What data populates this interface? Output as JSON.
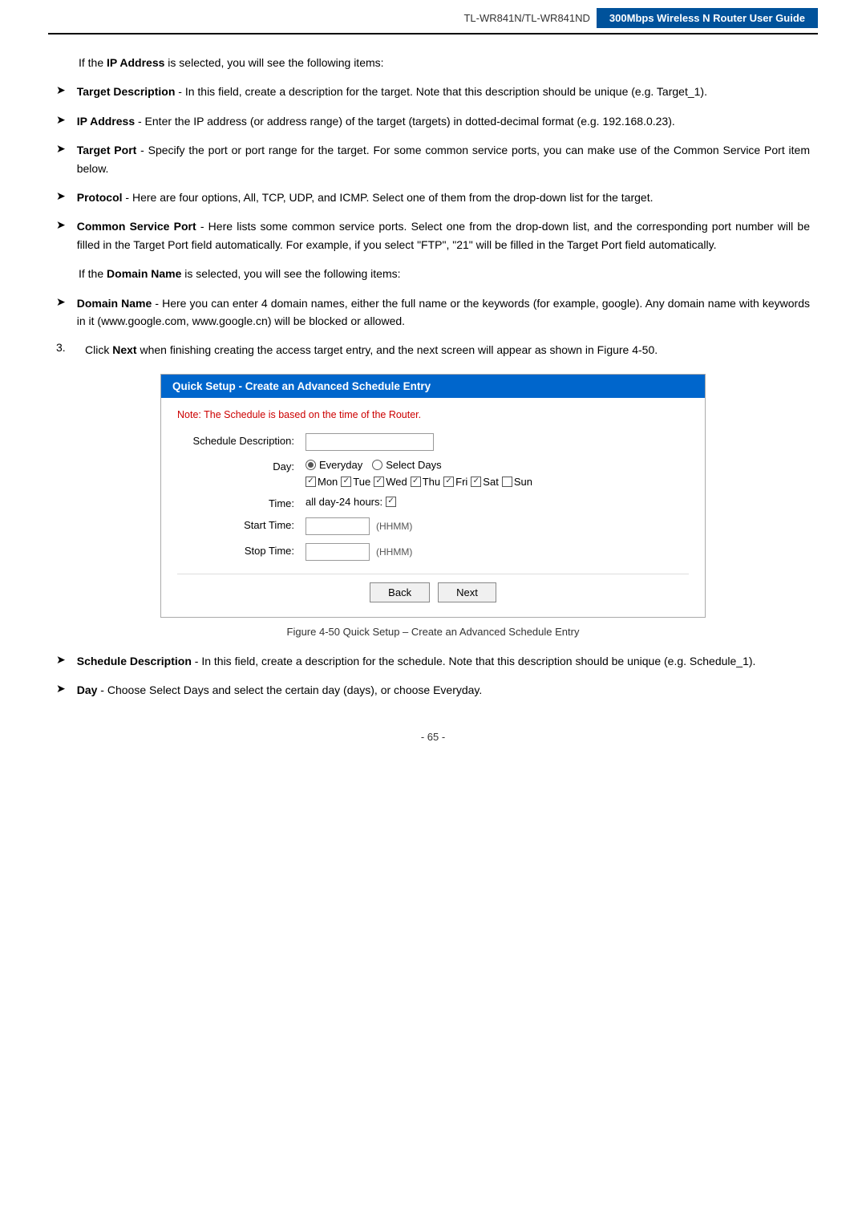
{
  "header": {
    "model": "TL-WR841N/TL-WR841ND",
    "title": "300Mbps Wireless N Router User Guide"
  },
  "bullets": [
    {
      "id": "target-description",
      "bold": "Target Description",
      "text": " - In this field, create a description for the target. Note that this description should be unique (e.g. Target_1)."
    },
    {
      "id": "ip-address",
      "bold": "IP Address",
      "text": " - Enter the IP address (or address range) of the target (targets) in dotted-decimal format (e.g. 192.168.0.23)."
    },
    {
      "id": "target-port",
      "bold": "Target Port",
      "text": " - Specify the port or port range for the target. For some common service ports, you can make use of the Common Service Port item below."
    },
    {
      "id": "protocol",
      "bold": "Protocol",
      "text": " - Here are four options, All, TCP, UDP, and ICMP. Select one of them from the drop-down list for the target."
    },
    {
      "id": "common-service-port",
      "bold": "Common Service Port",
      "text": " - Here lists some common service ports. Select one from the drop-down list, and the corresponding port number will be filled in the Target Port field automatically. For example, if you select \"FTP\", \"21\" will be filled in the Target Port field automatically."
    }
  ],
  "para1": "If the IP Address is selected, you will see the following items:",
  "para2": "If the Domain Name is selected, you will see the following items:",
  "domain_bullet": {
    "bold": "Domain Name",
    "text": " - Here you can enter 4 domain names, either the full name or the keywords (for example, google). Any domain name with keywords in it (www.google.com, www.google.cn) will be blocked or allowed."
  },
  "numbered": {
    "num": "3.",
    "text_pre": "Click ",
    "bold": "Next",
    "text_post": " when finishing creating the access target entry, and the next screen will appear as shown in Figure 4-50."
  },
  "schedule_panel": {
    "header": "Quick Setup - Create an Advanced Schedule Entry",
    "note": "Note: The Schedule is based on the time of the Router.",
    "fields": {
      "description_label": "Schedule Description:",
      "day_label": "Day:",
      "everyday_label": "Everyday",
      "select_days_label": "Select Days",
      "days": [
        {
          "label": "Mon",
          "checked": true
        },
        {
          "label": "Tue",
          "checked": true
        },
        {
          "label": "Wed",
          "checked": true
        },
        {
          "label": "Thu",
          "checked": true
        },
        {
          "label": "Fri",
          "checked": true
        },
        {
          "label": "Sat",
          "checked": true
        },
        {
          "label": "Sun",
          "checked": false
        }
      ],
      "time_label": "Time:",
      "all_day_label": "all day-24 hours:",
      "start_time_label": "Start Time:",
      "start_time_hint": "(HHMM)",
      "stop_time_label": "Stop Time:",
      "stop_time_hint": "(HHMM)"
    },
    "buttons": {
      "back": "Back",
      "next": "Next"
    }
  },
  "figure_caption": "Figure 4-50    Quick Setup – Create an Advanced Schedule Entry",
  "post_bullets": [
    {
      "bold": "Schedule Description",
      "text": " - In this field, create a description for the schedule. Note that this description should be unique (e.g. Schedule_1)."
    },
    {
      "bold": "Day",
      "text": " - Choose Select Days and select the certain day (days), or choose Everyday."
    }
  ],
  "page_number": "- 65 -"
}
